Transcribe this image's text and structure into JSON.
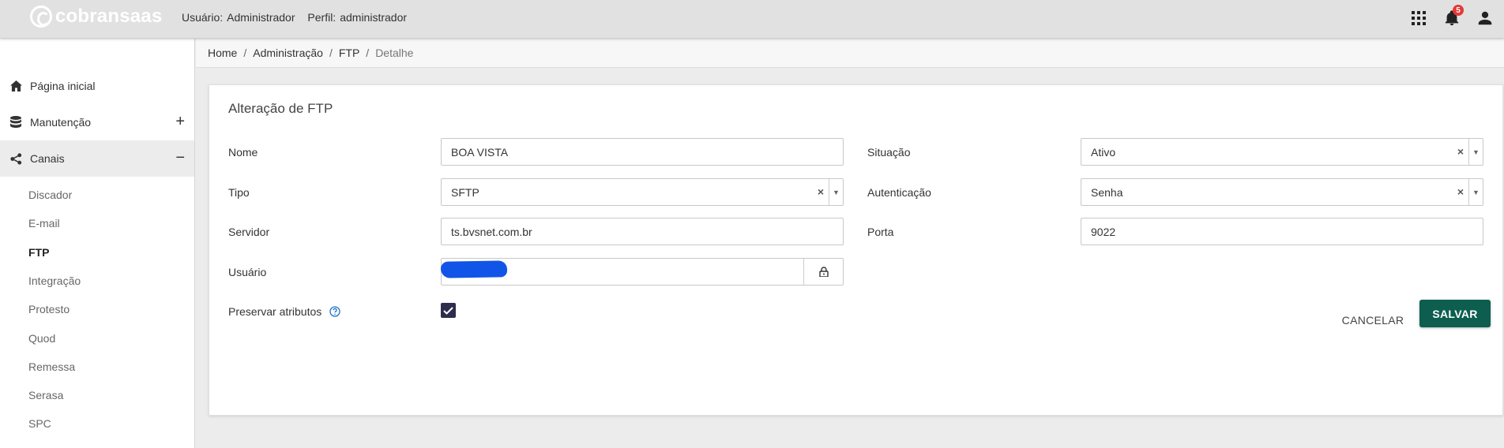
{
  "header": {
    "logo_text": "cobransaas",
    "user_label": "Usuário:",
    "user_value": "Administrador",
    "profile_label": "Perfil:",
    "profile_value": "administrador",
    "notification_count": "5",
    "icons": [
      "apps-grid-icon",
      "bell-icon",
      "account-icon"
    ]
  },
  "sidebar": {
    "items": [
      {
        "label": "Página inicial",
        "icon": "home-icon",
        "toggle": ""
      },
      {
        "label": "Manutenção",
        "icon": "database-icon",
        "toggle": "+"
      },
      {
        "label": "Canais",
        "icon": "share-icon",
        "toggle": "−"
      }
    ],
    "sub_items": [
      "Discador",
      "E-mail",
      "FTP",
      "Integração",
      "Protesto",
      "Quod",
      "Remessa",
      "Serasa",
      "SPC"
    ],
    "current_sub": "FTP"
  },
  "breadcrumb": [
    "Home",
    "Administração",
    "FTP",
    "Detalhe"
  ],
  "form": {
    "title": "Alteração de FTP",
    "nome_label": "Nome",
    "nome_value": "BOA VISTA",
    "situacao_label": "Situação",
    "situacao_value": "Ativo",
    "tipo_label": "Tipo",
    "tipo_value": "SFTP",
    "autenticacao_label": "Autenticação",
    "autenticacao_value": "Senha",
    "servidor_label": "Servidor",
    "servidor_value": "ts.bvsnet.com.br",
    "porta_label": "Porta",
    "porta_value": "9022",
    "usuario_label": "Usuário",
    "preservar_label": "Preservar atributos",
    "preservar_checked": true,
    "clear_glyph": "×",
    "arrow_glyph": "▼",
    "cancel_label": "CANCELAR",
    "save_label": "SALVAR"
  },
  "colors": {
    "accent": "#0d5e4f",
    "badge": "#e53935",
    "checkbox": "#2d2d4e",
    "redaction": "#1155e8"
  }
}
